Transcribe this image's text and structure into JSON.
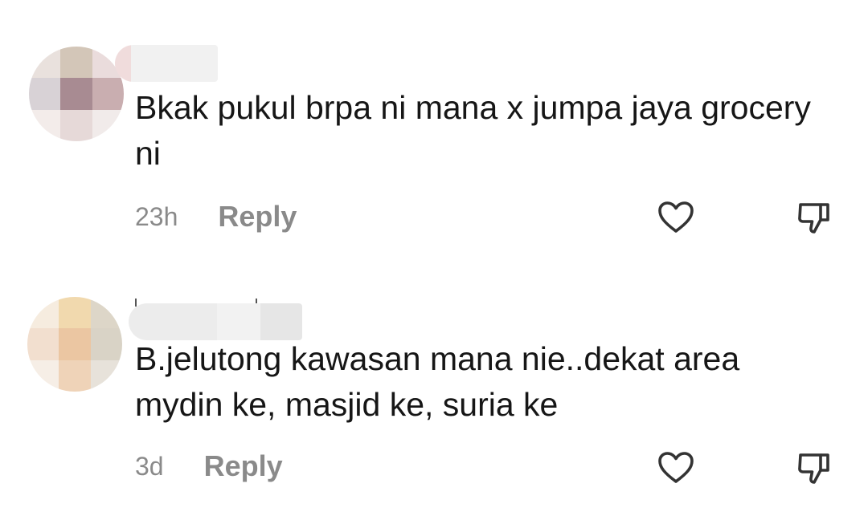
{
  "comments": [
    {
      "text": "Bkak pukul brpa ni mana x jumpa jaya grocery ni",
      "timestamp": "23h",
      "reply_label": "Reply"
    },
    {
      "text": "B.jelutong kawasan mana nie..dekat area mydin ke, masjid ke, suria ke",
      "timestamp": "3d",
      "reply_label": "Reply"
    }
  ],
  "icons": {
    "like": "heart-icon",
    "dislike": "thumbs-down-icon"
  },
  "colors": {
    "text": "#161616",
    "muted": "#8a8a8a",
    "icon": "#333333"
  }
}
